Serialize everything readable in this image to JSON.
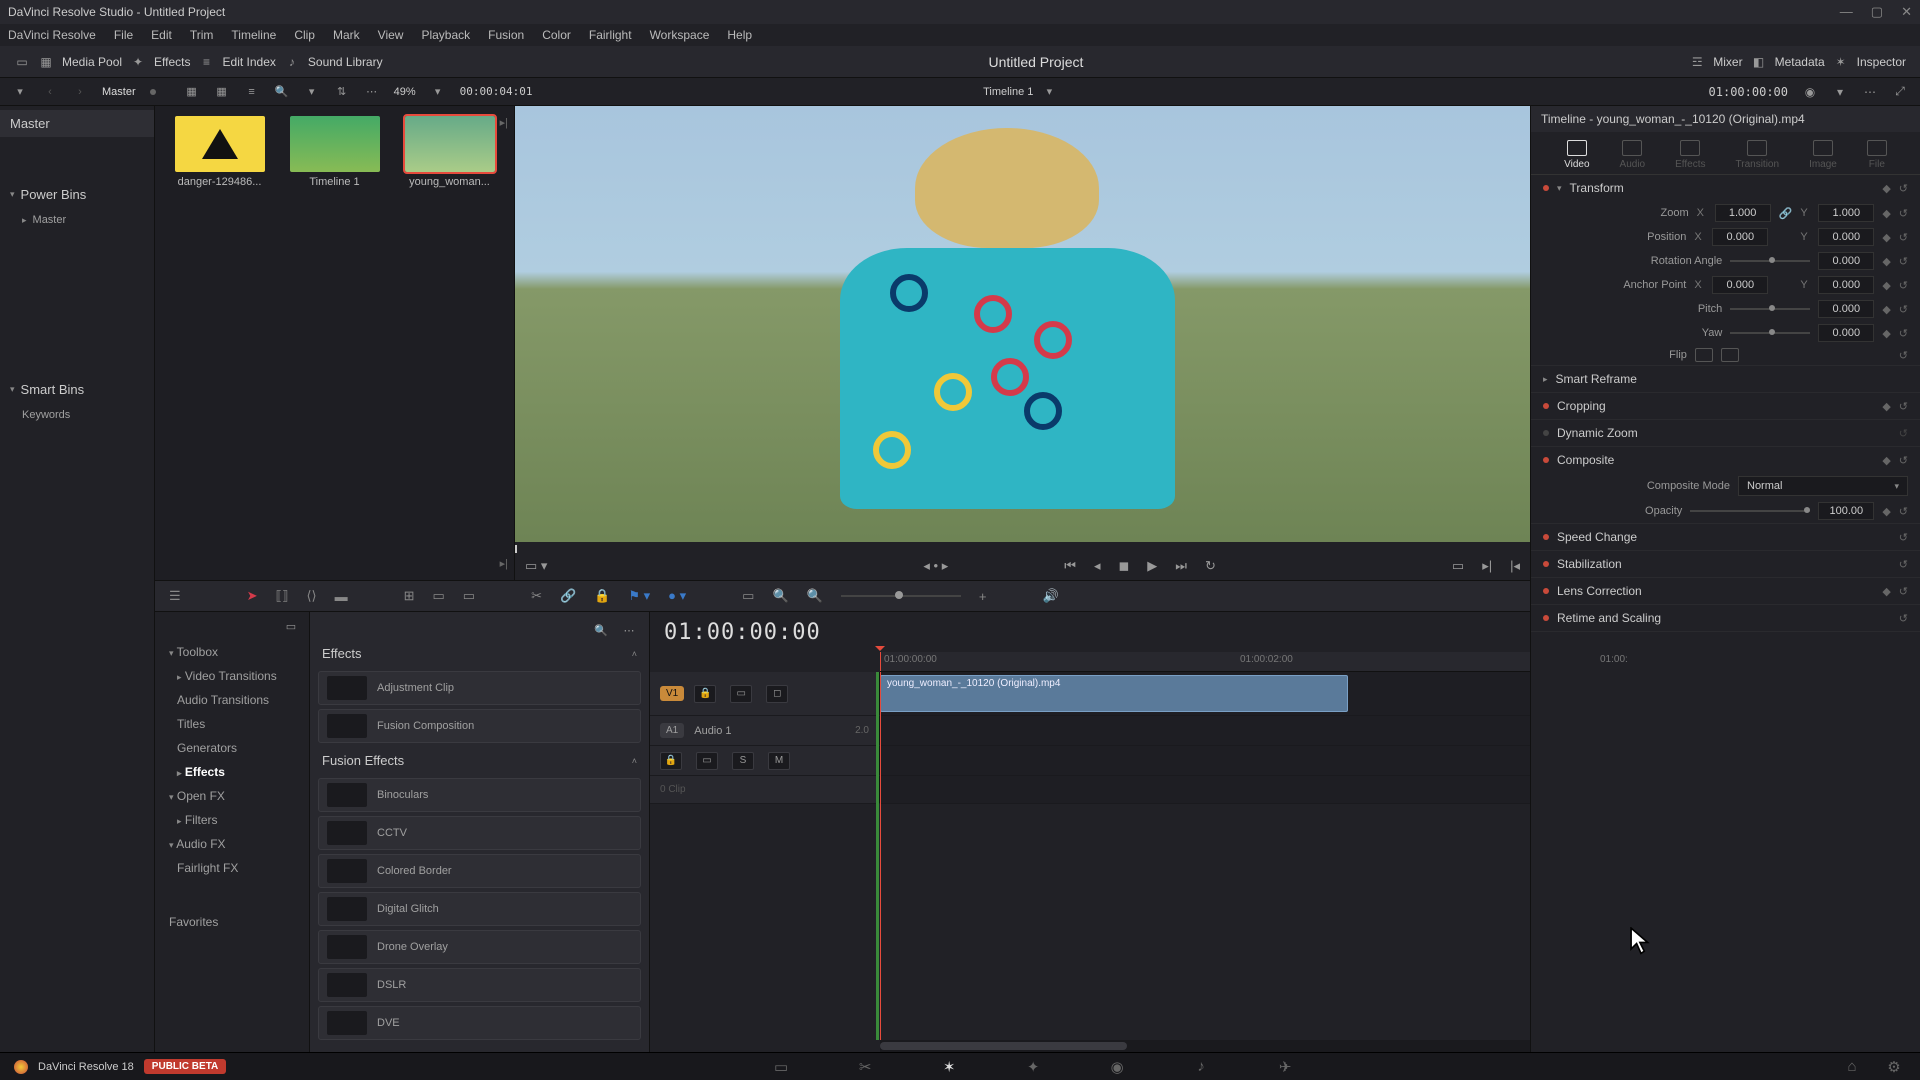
{
  "window": {
    "title": "DaVinci Resolve Studio - Untitled Project"
  },
  "menubar": [
    "DaVinci Resolve",
    "File",
    "Edit",
    "Trim",
    "Timeline",
    "Clip",
    "Mark",
    "View",
    "Playback",
    "Fusion",
    "Color",
    "Fairlight",
    "Workspace",
    "Help"
  ],
  "toolbar": {
    "media_pool": "Media Pool",
    "effects": "Effects",
    "edit_index": "Edit Index",
    "sound_library": "Sound Library",
    "mixer": "Mixer",
    "metadata": "Metadata",
    "inspector": "Inspector",
    "project_title": "Untitled Project"
  },
  "subtoolbar": {
    "bin_label": "Master",
    "zoom_pct": "49%",
    "source_tc": "00:00:04:01",
    "timeline_name": "Timeline 1",
    "record_tc": "01:00:00:00"
  },
  "bins": {
    "master": "Master",
    "power": "Power Bins",
    "power_master": "Master",
    "smart": "Smart Bins",
    "keywords": "Keywords",
    "favorites": "Favorites"
  },
  "thumbs": [
    {
      "label": "danger-129486...",
      "kind": "warning"
    },
    {
      "label": "Timeline 1",
      "kind": "timeline"
    },
    {
      "label": "young_woman...",
      "kind": "clip",
      "selected": true
    }
  ],
  "effects_tree": {
    "toolbox": "Toolbox",
    "video_transitions": "Video Transitions",
    "audio_transitions": "Audio Transitions",
    "titles": "Titles",
    "generators": "Generators",
    "effects": "Effects",
    "open_fx": "Open FX",
    "filters": "Filters",
    "audio_fx": "Audio FX",
    "fairlight_fx": "Fairlight FX"
  },
  "effects_panel": {
    "sec1": "Effects",
    "items1": [
      "Adjustment Clip",
      "Fusion Composition"
    ],
    "sec2": "Fusion Effects",
    "items2": [
      "Binoculars",
      "CCTV",
      "Colored Border",
      "Digital Glitch",
      "Drone Overlay",
      "DSLR",
      "DVE"
    ]
  },
  "timeline": {
    "tc": "01:00:00:00",
    "ruler": [
      "01:00:00:00",
      "01:00:02:00",
      "01:00:"
    ],
    "v1": "V1",
    "a1": "A1",
    "audio_name": "Audio 1",
    "audio_ch": "2.0",
    "zero_clip": "0 Clip",
    "s": "S",
    "m": "M",
    "clip_name": "young_woman_-_10120 (Original).mp4"
  },
  "inspector": {
    "header": "Timeline - young_woman_-_10120 (Original).mp4",
    "tabs": [
      "Video",
      "Audio",
      "Effects",
      "Transition",
      "Image",
      "File"
    ],
    "transform": "Transform",
    "zoom": "Zoom",
    "zoom_x": "1.000",
    "zoom_y": "1.000",
    "position": "Position",
    "pos_x": "0.000",
    "pos_y": "0.000",
    "rotation": "Rotation Angle",
    "rot_v": "0.000",
    "anchor": "Anchor Point",
    "anc_x": "0.000",
    "anc_y": "0.000",
    "pitch": "Pitch",
    "pitch_v": "0.000",
    "yaw": "Yaw",
    "yaw_v": "0.000",
    "flip": "Flip",
    "smart_reframe": "Smart Reframe",
    "cropping": "Cropping",
    "dynamic_zoom": "Dynamic Zoom",
    "composite": "Composite",
    "composite_mode": "Composite Mode",
    "composite_mode_val": "Normal",
    "opacity": "Opacity",
    "opacity_v": "100.00",
    "speed": "Speed Change",
    "stab": "Stabilization",
    "lens": "Lens Correction",
    "retime": "Retime and Scaling"
  },
  "bottom": {
    "app": "DaVinci Resolve 18",
    "beta": "PUBLIC BETA"
  }
}
